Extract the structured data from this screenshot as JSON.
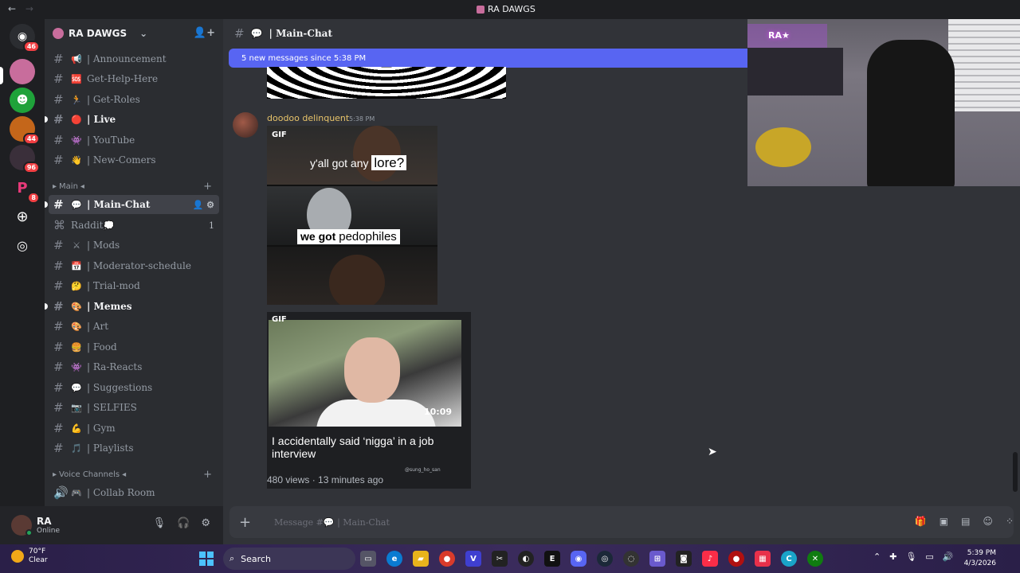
{
  "titlebar": {
    "title": "RA DAWGS",
    "back": "←",
    "forward": "→"
  },
  "rail": {
    "badges": [
      "46",
      "44",
      "96",
      "8"
    ]
  },
  "server": {
    "name": "RA DAWGS"
  },
  "channels": [
    {
      "emoji": "📢",
      "label": "| Announcement"
    },
    {
      "emoji": "🆘",
      "label": "Get-Help-Here"
    },
    {
      "emoji": "🏃",
      "label": "| Get-Roles"
    },
    {
      "emoji": "🔴",
      "label": "| Live"
    },
    {
      "emoji": "👾",
      "label": "| YouTube"
    },
    {
      "emoji": "👋",
      "label": "| New-Comers"
    },
    {
      "emoji": "💬",
      "label": "| Main-Chat"
    },
    {
      "emoji": "💭",
      "label": "Raddit",
      "count": "1"
    },
    {
      "emoji": "⚔",
      "label": "| Mods"
    },
    {
      "emoji": "📅",
      "label": "| Moderator-schedule"
    },
    {
      "emoji": "🤔",
      "label": "| Trial-mod"
    },
    {
      "emoji": "🎨",
      "label": "| Memes"
    },
    {
      "emoji": "🎨",
      "label": "| Art"
    },
    {
      "emoji": "🍔",
      "label": "| Food"
    },
    {
      "emoji": "👾",
      "label": "| Ra-Reacts"
    },
    {
      "emoji": "💬",
      "label": "| Suggestions"
    },
    {
      "emoji": "📷",
      "label": "| SELFIES"
    },
    {
      "emoji": "💪",
      "label": "| Gym"
    },
    {
      "emoji": "🎵",
      "label": "| Playlists"
    },
    {
      "emoji": "🎮",
      "label": "| Collab Room"
    }
  ],
  "categories": {
    "main": "Main",
    "voice": "Voice Channels"
  },
  "user": {
    "name": "RA",
    "status": "Online"
  },
  "chat": {
    "channel_title": "| Main-Chat",
    "new_messages": "5 new messages since 5:38 PM",
    "author": "doodoo delinquent",
    "timestamp": "5:38 PM",
    "gif_tag": "GIF",
    "meme_caption_1a": "y'all got any",
    "meme_caption_1b": "lore?",
    "meme_caption_2a": "we got",
    "meme_caption_2b": "pedophiles",
    "video_duration": "10:09",
    "video_title": "I accidentally said ‘nigga’ in a job interview",
    "video_handle": "@sung_ho_san",
    "video_meta": "480 views · 13 minutes ago",
    "composer_placeholder": "Message #💬 | Main-Chat",
    "webcam_neon": "RA★"
  },
  "taskbar": {
    "temp": "70°F",
    "condition": "Clear",
    "search": "Search",
    "time": "5:39 PM",
    "date": "4/3/2026"
  },
  "colors": {
    "accent": "#5865f2",
    "author": "#e8c46a",
    "online": "#23a55a",
    "badge": "#f23f43"
  }
}
